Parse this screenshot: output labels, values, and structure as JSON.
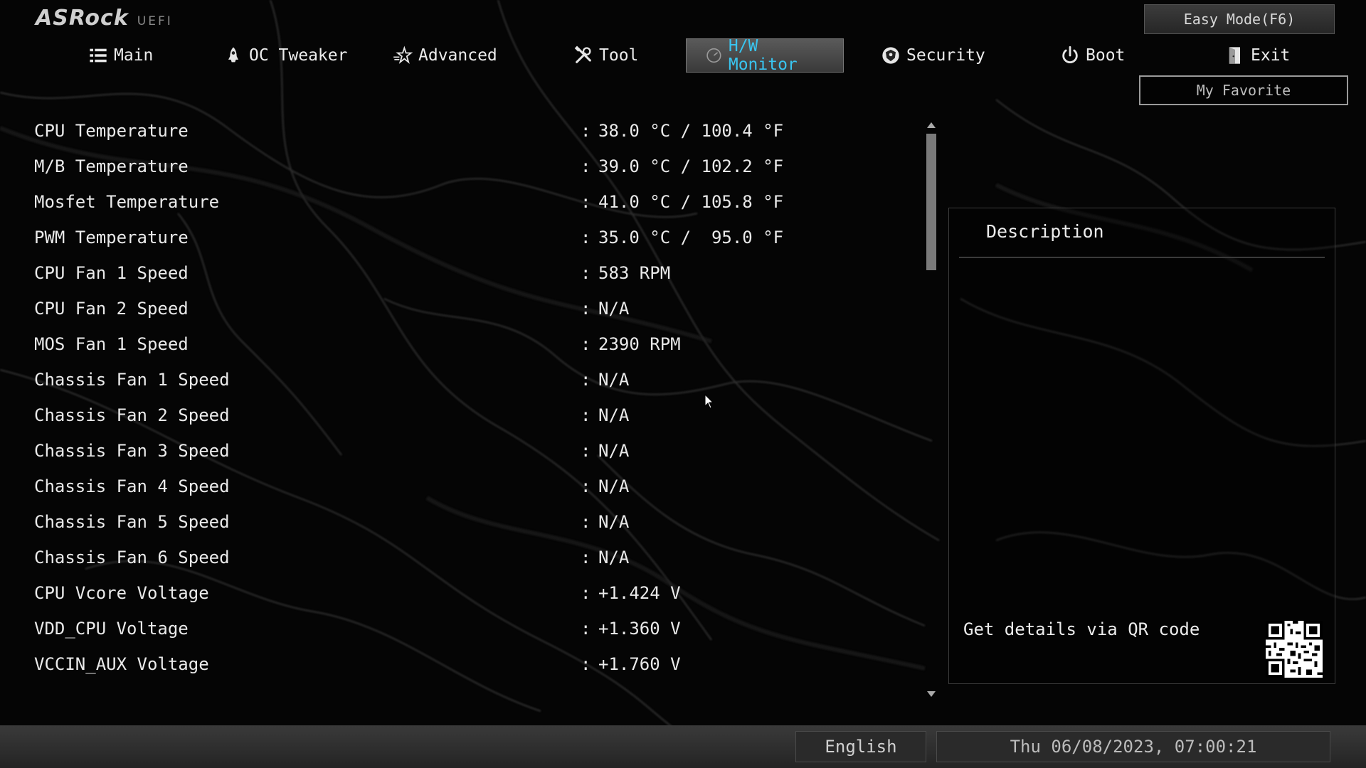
{
  "header": {
    "brand": "ASRock",
    "subtitle": "UEFI",
    "easy_mode_label": "Easy Mode(F6)",
    "my_favorite_label": "My Favorite"
  },
  "tabs": [
    {
      "label": "Main",
      "icon": "list-icon"
    },
    {
      "label": "OC Tweaker",
      "icon": "rocket-icon"
    },
    {
      "label": "Advanced",
      "icon": "star-icon"
    },
    {
      "label": "Tool",
      "icon": "tools-icon"
    },
    {
      "label": "H/W Monitor",
      "icon": "monitor-icon",
      "active": true
    },
    {
      "label": "Security",
      "icon": "shield-icon"
    },
    {
      "label": "Boot",
      "icon": "power-icon"
    },
    {
      "label": "Exit",
      "icon": "exit-door-icon"
    }
  ],
  "monitor": {
    "rows": [
      {
        "label": "CPU Temperature",
        "value": "38.0 °C / 100.4 °F"
      },
      {
        "label": "M/B Temperature",
        "value": "39.0 °C / 102.2 °F"
      },
      {
        "label": "Mosfet Temperature",
        "value": "41.0 °C / 105.8 °F"
      },
      {
        "label": "PWM Temperature",
        "value": "35.0 °C /  95.0 °F"
      },
      {
        "label": "CPU Fan 1 Speed",
        "value": "583 RPM"
      },
      {
        "label": "CPU Fan 2 Speed",
        "value": "N/A"
      },
      {
        "label": "MOS Fan 1 Speed",
        "value": "2390 RPM"
      },
      {
        "label": "Chassis Fan 1 Speed",
        "value": "N/A"
      },
      {
        "label": "Chassis Fan 2 Speed",
        "value": "N/A"
      },
      {
        "label": "Chassis Fan 3 Speed",
        "value": "N/A"
      },
      {
        "label": "Chassis Fan 4 Speed",
        "value": "N/A"
      },
      {
        "label": "Chassis Fan 5 Speed",
        "value": "N/A"
      },
      {
        "label": "Chassis Fan 6 Speed",
        "value": "N/A"
      },
      {
        "label": "CPU Vcore Voltage",
        "value": "+1.424 V"
      },
      {
        "label": "VDD_CPU Voltage",
        "value": "+1.360 V"
      },
      {
        "label": "VCCIN_AUX Voltage",
        "value": "+1.760 V"
      }
    ],
    "separator": ":"
  },
  "description": {
    "title": "Description",
    "qr_text": "Get details via QR code"
  },
  "status_bar": {
    "language": "English",
    "datetime": "Thu 06/08/2023, 07:00:21"
  },
  "colors": {
    "accent": "#39c5f0",
    "background": "#050505"
  }
}
